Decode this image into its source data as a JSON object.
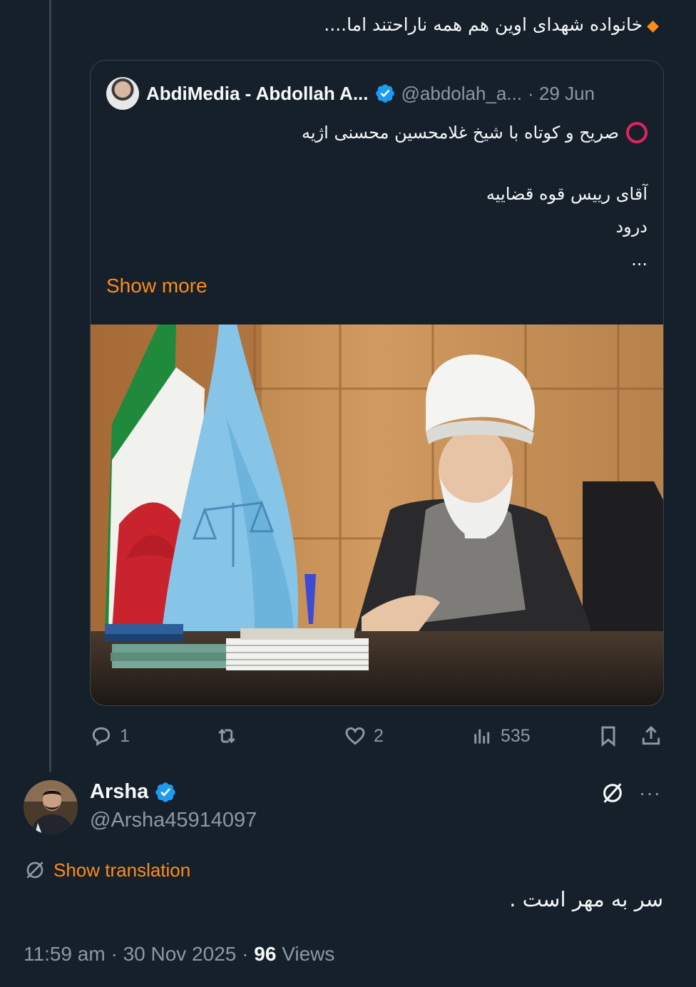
{
  "parent_tweet": {
    "text": "خانواده شهدای اوین هم همه ناراحتند اما...."
  },
  "quote": {
    "author_name": "AbdiMedia - Abdollah A...",
    "handle": "@abdolah_a...",
    "date": "· 29 Jun",
    "line1": "صریح و کوتاه با شیخ غلامحسین محسنی اژیه",
    "line2": "آقای رییس قوه قضاییه",
    "line3": "درود",
    "line4": "...",
    "show_more": "Show more"
  },
  "actions": {
    "replies": "1",
    "likes": "2",
    "views": "535"
  },
  "reply": {
    "author_name": "Arsha",
    "handle": "@Arsha45914097",
    "show_translation": "Show translation",
    "text": "سر به مهر است .",
    "time": "11:59 am",
    "date": "30 Nov 2025",
    "views_count": "96",
    "views_label": "Views"
  },
  "colors": {
    "background": "#15202b",
    "accent": "#ff8c1a",
    "verified": "#1d9bf0",
    "muted": "#8b98a5"
  }
}
